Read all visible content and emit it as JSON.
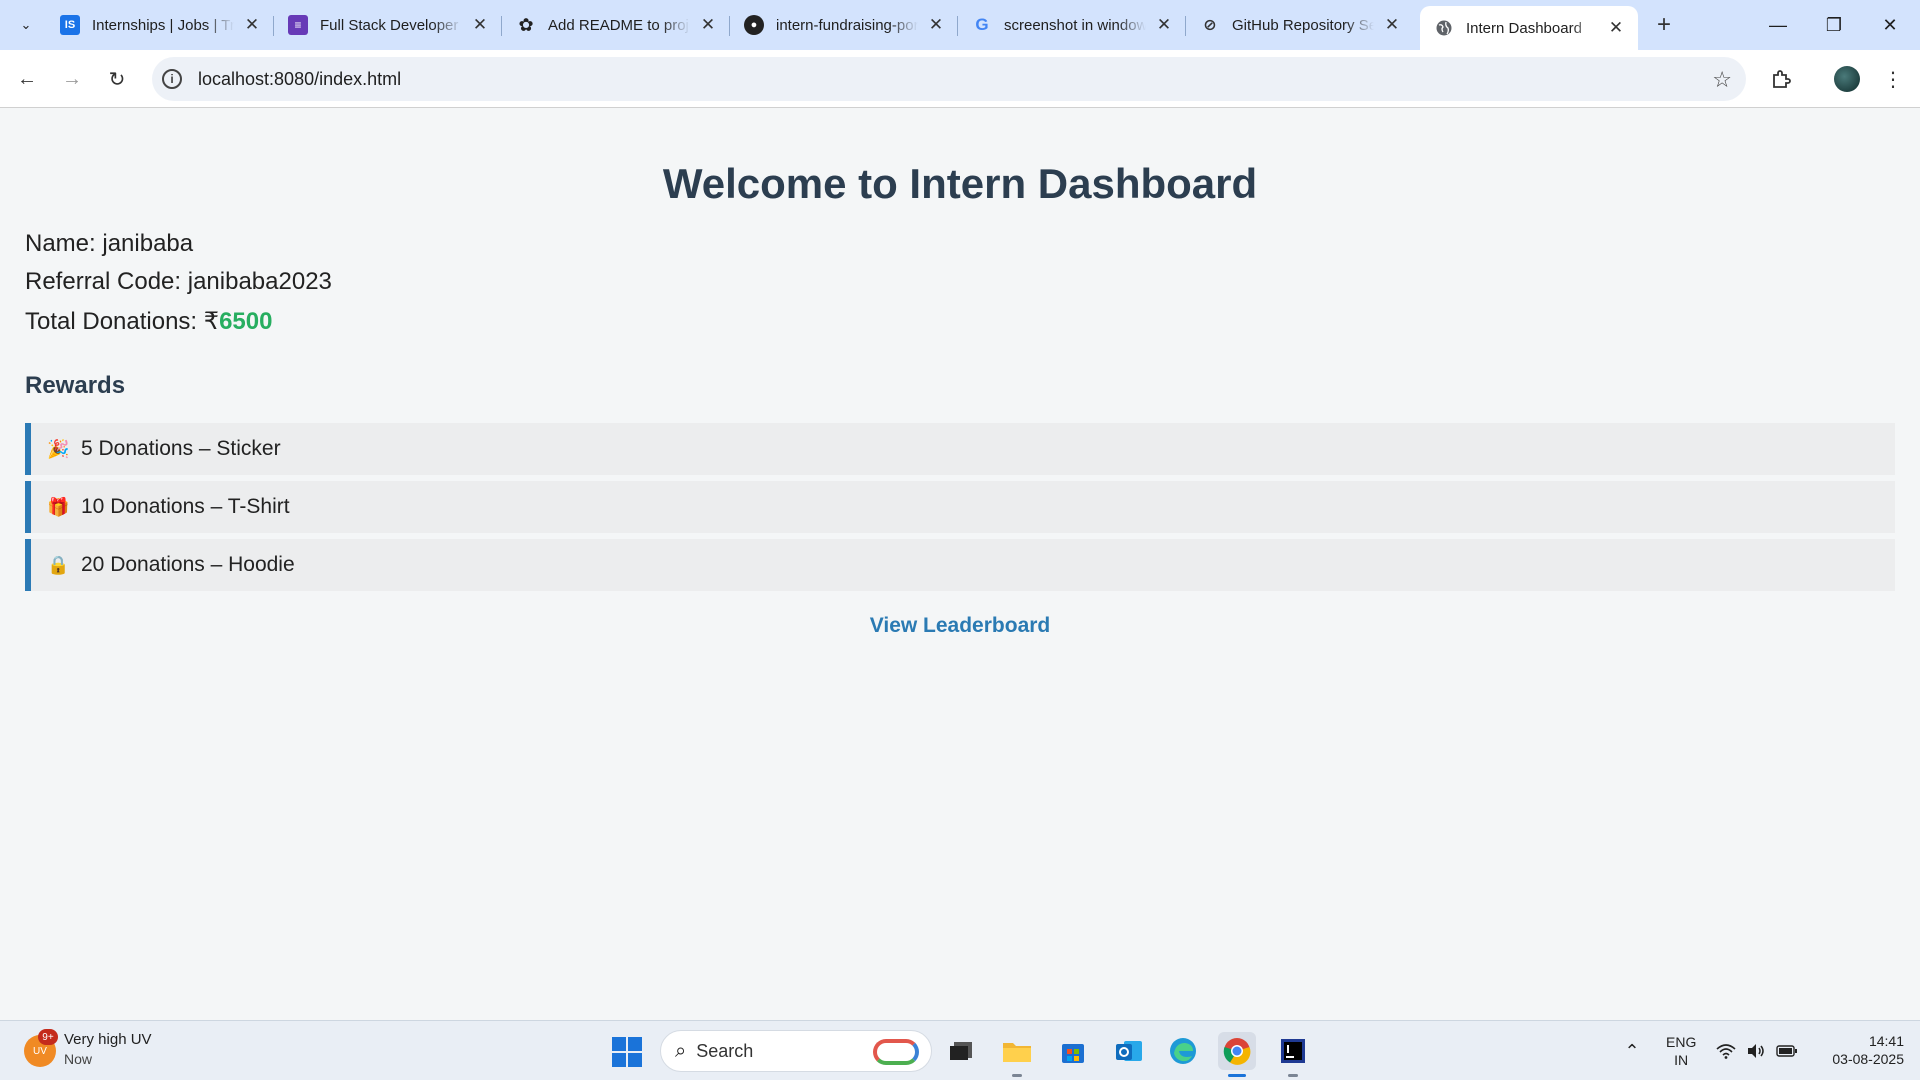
{
  "browser": {
    "tabs": [
      {
        "title": "Internships | Jobs | Training",
        "favicon": "IS",
        "color": "#1a73e8"
      },
      {
        "title": "Full Stack Developer",
        "favicon": "forms-icon",
        "color": "#673ab7"
      },
      {
        "title": "Add README to project",
        "favicon": "openai-icon",
        "color": "#222222"
      },
      {
        "title": "intern-fundraising-portal",
        "favicon": "github-icon",
        "color": "#222222"
      },
      {
        "title": "screenshot in windows",
        "favicon": "G",
        "color": "#4285f4"
      },
      {
        "title": "GitHub Repository Setup",
        "favicon": "assistant-icon",
        "color": "#333333"
      },
      {
        "title": "Intern Dashboard",
        "favicon": "globe-icon",
        "color": "#444444"
      }
    ],
    "active_tab": 6,
    "url": "localhost:8080/index.html"
  },
  "page": {
    "heading": "Welcome to Intern Dashboard",
    "name_label": "Name: ",
    "name_value": "janibaba",
    "referral_label": "Referral Code: ",
    "referral_value": "janibaba2023",
    "donations_label": "Total Donations: ",
    "currency": "₹",
    "donations_value": "6500",
    "rewards_heading": "Rewards",
    "rewards": [
      {
        "emoji": "🎉",
        "text": "5 Donations – Sticker"
      },
      {
        "emoji": "🎁",
        "text": "10 Donations – T-Shirt"
      },
      {
        "emoji": "🔒",
        "text": "20 Donations – Hoodie"
      }
    ],
    "leaderboard_link": "View Leaderboard",
    "accent_color": "#2b7ab5",
    "amount_color": "#27ae60"
  },
  "taskbar": {
    "weather_badge": "9+",
    "weather_icon_text": "UV",
    "weather_title": "Very high UV",
    "weather_sub": "Now",
    "search_label": "Search",
    "lang_top": "ENG",
    "lang_bottom": "IN",
    "time": "14:41",
    "date": "03-08-2025"
  }
}
